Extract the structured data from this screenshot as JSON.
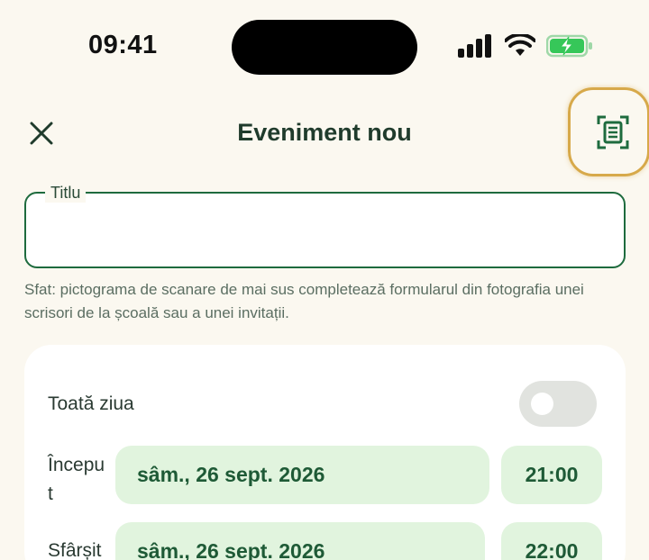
{
  "status_bar": {
    "time": "09:41"
  },
  "header": {
    "title": "Eveniment nou"
  },
  "title_field": {
    "label": "Titlu",
    "value": ""
  },
  "hint": "Sfat: pictograma de scanare de mai sus completează formularul din fotografia unei scrisori de la școală sau a unei invitații.",
  "all_day": {
    "label": "Toată ziua",
    "enabled": false
  },
  "start": {
    "label": "Începu\nt",
    "date": "sâm., 26 sept. 2026",
    "time": "21:00"
  },
  "end": {
    "label": "Sfârșit",
    "date": "sâm., 26 sept. 2026",
    "time": "22:00"
  },
  "colors": {
    "accent": "#1E6B3E",
    "pill_bg": "#E1F4DE",
    "highlight": "#D7A94A",
    "battery": "#36C759"
  }
}
